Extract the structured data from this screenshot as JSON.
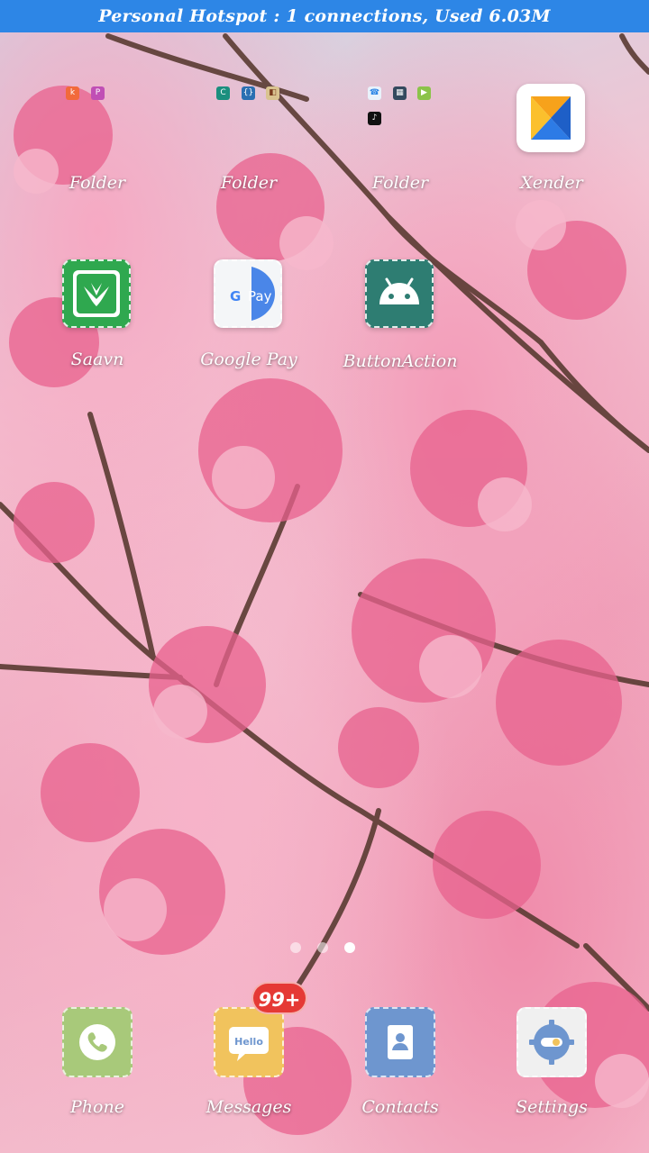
{
  "status_bar": {
    "text": "Personal Hotspot : 1 connections, Used 6.03M"
  },
  "home": {
    "row1": [
      {
        "label": "Folder",
        "mini_icons": [
          "k",
          "P"
        ]
      },
      {
        "label": "Folder",
        "mini_icons": [
          "C",
          "{}",
          "◧"
        ]
      },
      {
        "label": "Folder",
        "mini_icons": [
          "☎",
          "▦",
          "▶",
          "♪"
        ]
      },
      {
        "label": "Xender"
      }
    ],
    "row2": [
      {
        "label": "Saavn"
      },
      {
        "label": "Google Pay",
        "icon_text": "G Pay"
      },
      {
        "label": "ButtonAction"
      }
    ]
  },
  "page_indicator": {
    "count": 3,
    "active": 3
  },
  "dock": [
    {
      "label": "Phone"
    },
    {
      "label": "Messages",
      "icon_text": "Hello",
      "badge": "99+"
    },
    {
      "label": "Contacts"
    },
    {
      "label": "Settings"
    }
  ],
  "colors": {
    "status_bar": "#2d86e6",
    "badge": "#e53935",
    "saavn": "#2fa84f",
    "android_tile": "#2e7d72",
    "phone_tile": "#a8c97a",
    "messages_tile": "#f1c35d",
    "contacts_tile": "#6e96cf",
    "settings_tile": "#f0f0f0"
  }
}
